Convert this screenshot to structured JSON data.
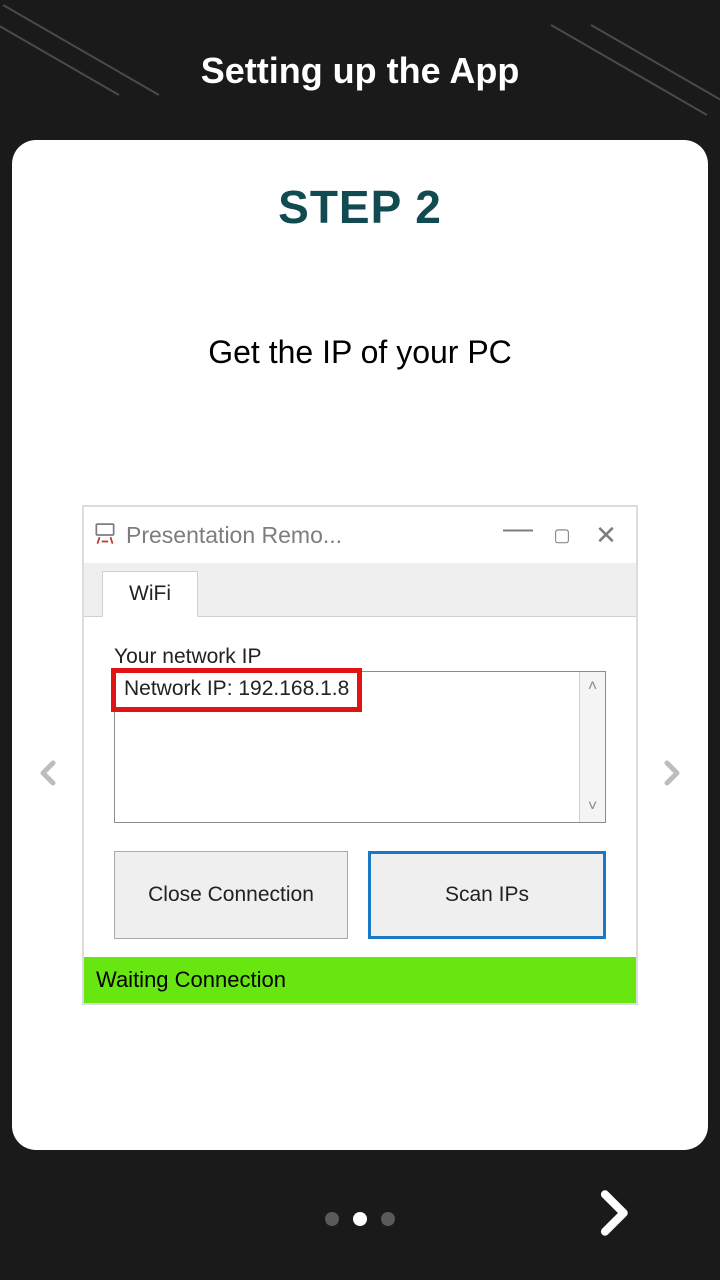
{
  "header": {
    "title": "Setting up the App"
  },
  "step": {
    "title": "STEP 2",
    "instruction": "Get the IP of your PC"
  },
  "window": {
    "title": "Presentation Remo...",
    "tab": "WiFi",
    "network_label": "Your network IP",
    "ip_value": "Network IP: 192.168.1.8",
    "buttons": {
      "close_connection": "Close Connection",
      "scan_ips": "Scan IPs"
    },
    "status": "Waiting Connection"
  },
  "pager": {
    "total": 3,
    "active_index": 1
  }
}
